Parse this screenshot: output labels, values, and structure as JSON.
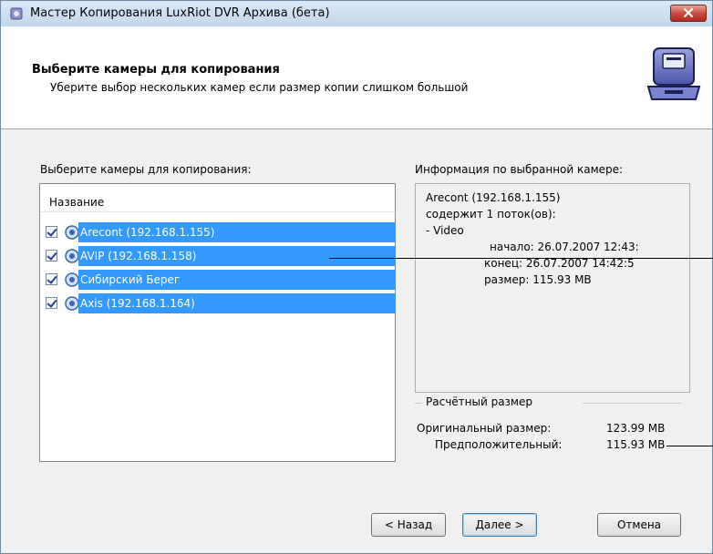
{
  "window": {
    "title": "Мастер Копирования LuxRiot DVR Архива (бета)"
  },
  "header": {
    "title": "Выберите камеры для копирования",
    "subtitle": "Уберите выбор нескольких камер если размер копии слишком большой"
  },
  "left": {
    "label": "Выберите камеры для копирования:",
    "column_header": "Название",
    "cameras": [
      {
        "label": "Arecont (192.168.1.155)",
        "checked": true
      },
      {
        "label": "AVIP (192.168.1.158)",
        "checked": true
      },
      {
        "label": "Сибирский Берег",
        "checked": true
      },
      {
        "label": "Axis (192.168.1.164)",
        "checked": true
      }
    ]
  },
  "info": {
    "label": "Информация по выбранной камере:",
    "lines": [
      "Arecont (192.168.1.155)",
      "содержит 1 поток(ов):",
      " - Video",
      "начало: 26.07.2007 12:43:",
      "конец: 26.07.2007 14:42:5",
      "размер: 115.93 MB"
    ]
  },
  "estimate": {
    "group_label": "Расчётный размер",
    "original_label": "Оригинальный размер:",
    "original_value": "123.99 MB",
    "estimated_label": "Предположительный:",
    "estimated_value": "115.93 MB"
  },
  "buttons": {
    "back": "< Назад",
    "next": "Далее >",
    "cancel": "Отмена"
  },
  "colors": {
    "selection": "#3399ff",
    "close": "#c8483a"
  }
}
